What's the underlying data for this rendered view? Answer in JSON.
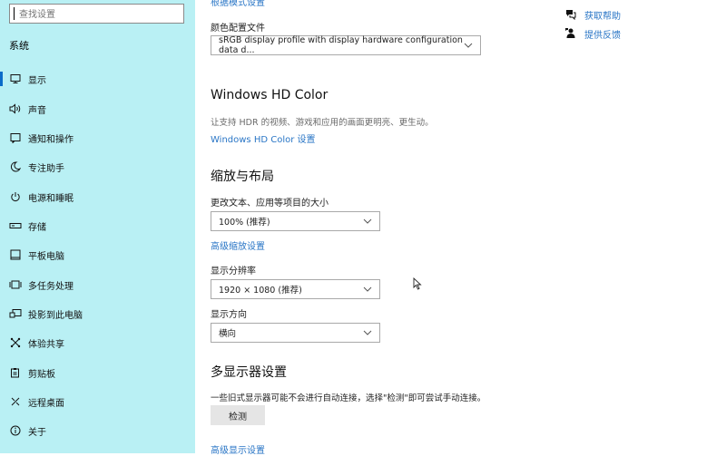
{
  "sidebar": {
    "search_placeholder": "查找设置",
    "header": "系统",
    "items": [
      {
        "label": "显示",
        "icon": "monitor-icon"
      },
      {
        "label": "声音",
        "icon": "speaker-icon"
      },
      {
        "label": "通知和操作",
        "icon": "notification-icon"
      },
      {
        "label": "专注助手",
        "icon": "moon-icon"
      },
      {
        "label": "电源和睡眠",
        "icon": "power-icon"
      },
      {
        "label": "存储",
        "icon": "storage-icon"
      },
      {
        "label": "平板电脑",
        "icon": "tablet-icon"
      },
      {
        "label": "多任务处理",
        "icon": "multitask-icon"
      },
      {
        "label": "投影到此电脑",
        "icon": "project-icon"
      },
      {
        "label": "体验共享",
        "icon": "share-icon"
      },
      {
        "label": "剪贴板",
        "icon": "clipboard-icon"
      },
      {
        "label": "远程桌面",
        "icon": "remote-icon"
      },
      {
        "label": "关于",
        "icon": "info-icon"
      }
    ]
  },
  "main": {
    "top_link": "根据模式设置",
    "color_profile": {
      "label": "颜色配置文件",
      "value": "sRGB display profile with display hardware configuration data d..."
    },
    "hdr": {
      "title": "Windows HD Color",
      "desc": "让支持 HDR 的视频、游戏和应用的画面更明亮、更生动。",
      "link": "Windows HD Color 设置"
    },
    "scale": {
      "title": "缩放与布局",
      "size_label": "更改文本、应用等项目的大小",
      "size_value": "100% (推荐)",
      "advanced_link": "高级缩放设置",
      "resolution_label": "显示分辨率",
      "resolution_value": "1920 × 1080 (推荐)",
      "orientation_label": "显示方向",
      "orientation_value": "横向"
    },
    "multi": {
      "title": "多显示器设置",
      "desc": "一些旧式显示器可能不会进行自动连接，选择\"检测\"即可尝试手动连接。",
      "detect_button": "检测",
      "advanced_link": "高级显示设置"
    }
  },
  "help": {
    "get_help": "获取帮助",
    "feedback": "提供反馈"
  }
}
